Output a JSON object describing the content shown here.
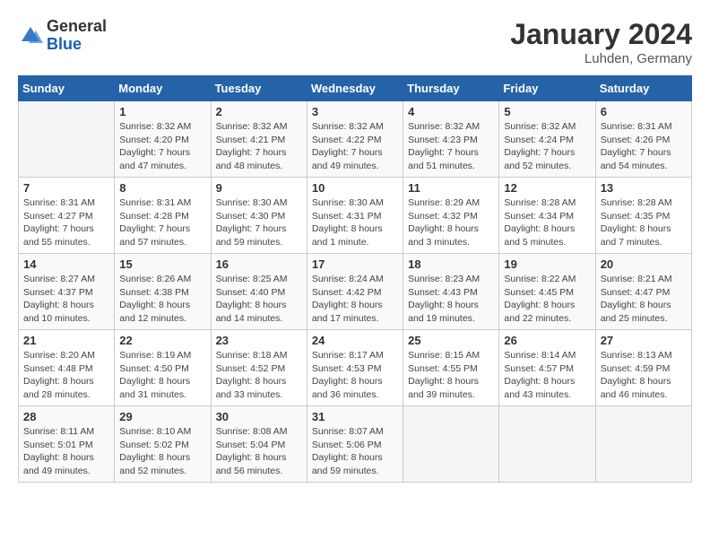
{
  "logo": {
    "general": "General",
    "blue": "Blue"
  },
  "header": {
    "month_year": "January 2024",
    "location": "Luhden, Germany"
  },
  "days_of_week": [
    "Sunday",
    "Monday",
    "Tuesday",
    "Wednesday",
    "Thursday",
    "Friday",
    "Saturday"
  ],
  "weeks": [
    [
      {
        "day": "",
        "info": ""
      },
      {
        "day": "1",
        "info": "Sunrise: 8:32 AM\nSunset: 4:20 PM\nDaylight: 7 hours\nand 47 minutes."
      },
      {
        "day": "2",
        "info": "Sunrise: 8:32 AM\nSunset: 4:21 PM\nDaylight: 7 hours\nand 48 minutes."
      },
      {
        "day": "3",
        "info": "Sunrise: 8:32 AM\nSunset: 4:22 PM\nDaylight: 7 hours\nand 49 minutes."
      },
      {
        "day": "4",
        "info": "Sunrise: 8:32 AM\nSunset: 4:23 PM\nDaylight: 7 hours\nand 51 minutes."
      },
      {
        "day": "5",
        "info": "Sunrise: 8:32 AM\nSunset: 4:24 PM\nDaylight: 7 hours\nand 52 minutes."
      },
      {
        "day": "6",
        "info": "Sunrise: 8:31 AM\nSunset: 4:26 PM\nDaylight: 7 hours\nand 54 minutes."
      }
    ],
    [
      {
        "day": "7",
        "info": "Sunrise: 8:31 AM\nSunset: 4:27 PM\nDaylight: 7 hours\nand 55 minutes."
      },
      {
        "day": "8",
        "info": "Sunrise: 8:31 AM\nSunset: 4:28 PM\nDaylight: 7 hours\nand 57 minutes."
      },
      {
        "day": "9",
        "info": "Sunrise: 8:30 AM\nSunset: 4:30 PM\nDaylight: 7 hours\nand 59 minutes."
      },
      {
        "day": "10",
        "info": "Sunrise: 8:30 AM\nSunset: 4:31 PM\nDaylight: 8 hours\nand 1 minute."
      },
      {
        "day": "11",
        "info": "Sunrise: 8:29 AM\nSunset: 4:32 PM\nDaylight: 8 hours\nand 3 minutes."
      },
      {
        "day": "12",
        "info": "Sunrise: 8:28 AM\nSunset: 4:34 PM\nDaylight: 8 hours\nand 5 minutes."
      },
      {
        "day": "13",
        "info": "Sunrise: 8:28 AM\nSunset: 4:35 PM\nDaylight: 8 hours\nand 7 minutes."
      }
    ],
    [
      {
        "day": "14",
        "info": "Sunrise: 8:27 AM\nSunset: 4:37 PM\nDaylight: 8 hours\nand 10 minutes."
      },
      {
        "day": "15",
        "info": "Sunrise: 8:26 AM\nSunset: 4:38 PM\nDaylight: 8 hours\nand 12 minutes."
      },
      {
        "day": "16",
        "info": "Sunrise: 8:25 AM\nSunset: 4:40 PM\nDaylight: 8 hours\nand 14 minutes."
      },
      {
        "day": "17",
        "info": "Sunrise: 8:24 AM\nSunset: 4:42 PM\nDaylight: 8 hours\nand 17 minutes."
      },
      {
        "day": "18",
        "info": "Sunrise: 8:23 AM\nSunset: 4:43 PM\nDaylight: 8 hours\nand 19 minutes."
      },
      {
        "day": "19",
        "info": "Sunrise: 8:22 AM\nSunset: 4:45 PM\nDaylight: 8 hours\nand 22 minutes."
      },
      {
        "day": "20",
        "info": "Sunrise: 8:21 AM\nSunset: 4:47 PM\nDaylight: 8 hours\nand 25 minutes."
      }
    ],
    [
      {
        "day": "21",
        "info": "Sunrise: 8:20 AM\nSunset: 4:48 PM\nDaylight: 8 hours\nand 28 minutes."
      },
      {
        "day": "22",
        "info": "Sunrise: 8:19 AM\nSunset: 4:50 PM\nDaylight: 8 hours\nand 31 minutes."
      },
      {
        "day": "23",
        "info": "Sunrise: 8:18 AM\nSunset: 4:52 PM\nDaylight: 8 hours\nand 33 minutes."
      },
      {
        "day": "24",
        "info": "Sunrise: 8:17 AM\nSunset: 4:53 PM\nDaylight: 8 hours\nand 36 minutes."
      },
      {
        "day": "25",
        "info": "Sunrise: 8:15 AM\nSunset: 4:55 PM\nDaylight: 8 hours\nand 39 minutes."
      },
      {
        "day": "26",
        "info": "Sunrise: 8:14 AM\nSunset: 4:57 PM\nDaylight: 8 hours\nand 43 minutes."
      },
      {
        "day": "27",
        "info": "Sunrise: 8:13 AM\nSunset: 4:59 PM\nDaylight: 8 hours\nand 46 minutes."
      }
    ],
    [
      {
        "day": "28",
        "info": "Sunrise: 8:11 AM\nSunset: 5:01 PM\nDaylight: 8 hours\nand 49 minutes."
      },
      {
        "day": "29",
        "info": "Sunrise: 8:10 AM\nSunset: 5:02 PM\nDaylight: 8 hours\nand 52 minutes."
      },
      {
        "day": "30",
        "info": "Sunrise: 8:08 AM\nSunset: 5:04 PM\nDaylight: 8 hours\nand 56 minutes."
      },
      {
        "day": "31",
        "info": "Sunrise: 8:07 AM\nSunset: 5:06 PM\nDaylight: 8 hours\nand 59 minutes."
      },
      {
        "day": "",
        "info": ""
      },
      {
        "day": "",
        "info": ""
      },
      {
        "day": "",
        "info": ""
      }
    ]
  ]
}
